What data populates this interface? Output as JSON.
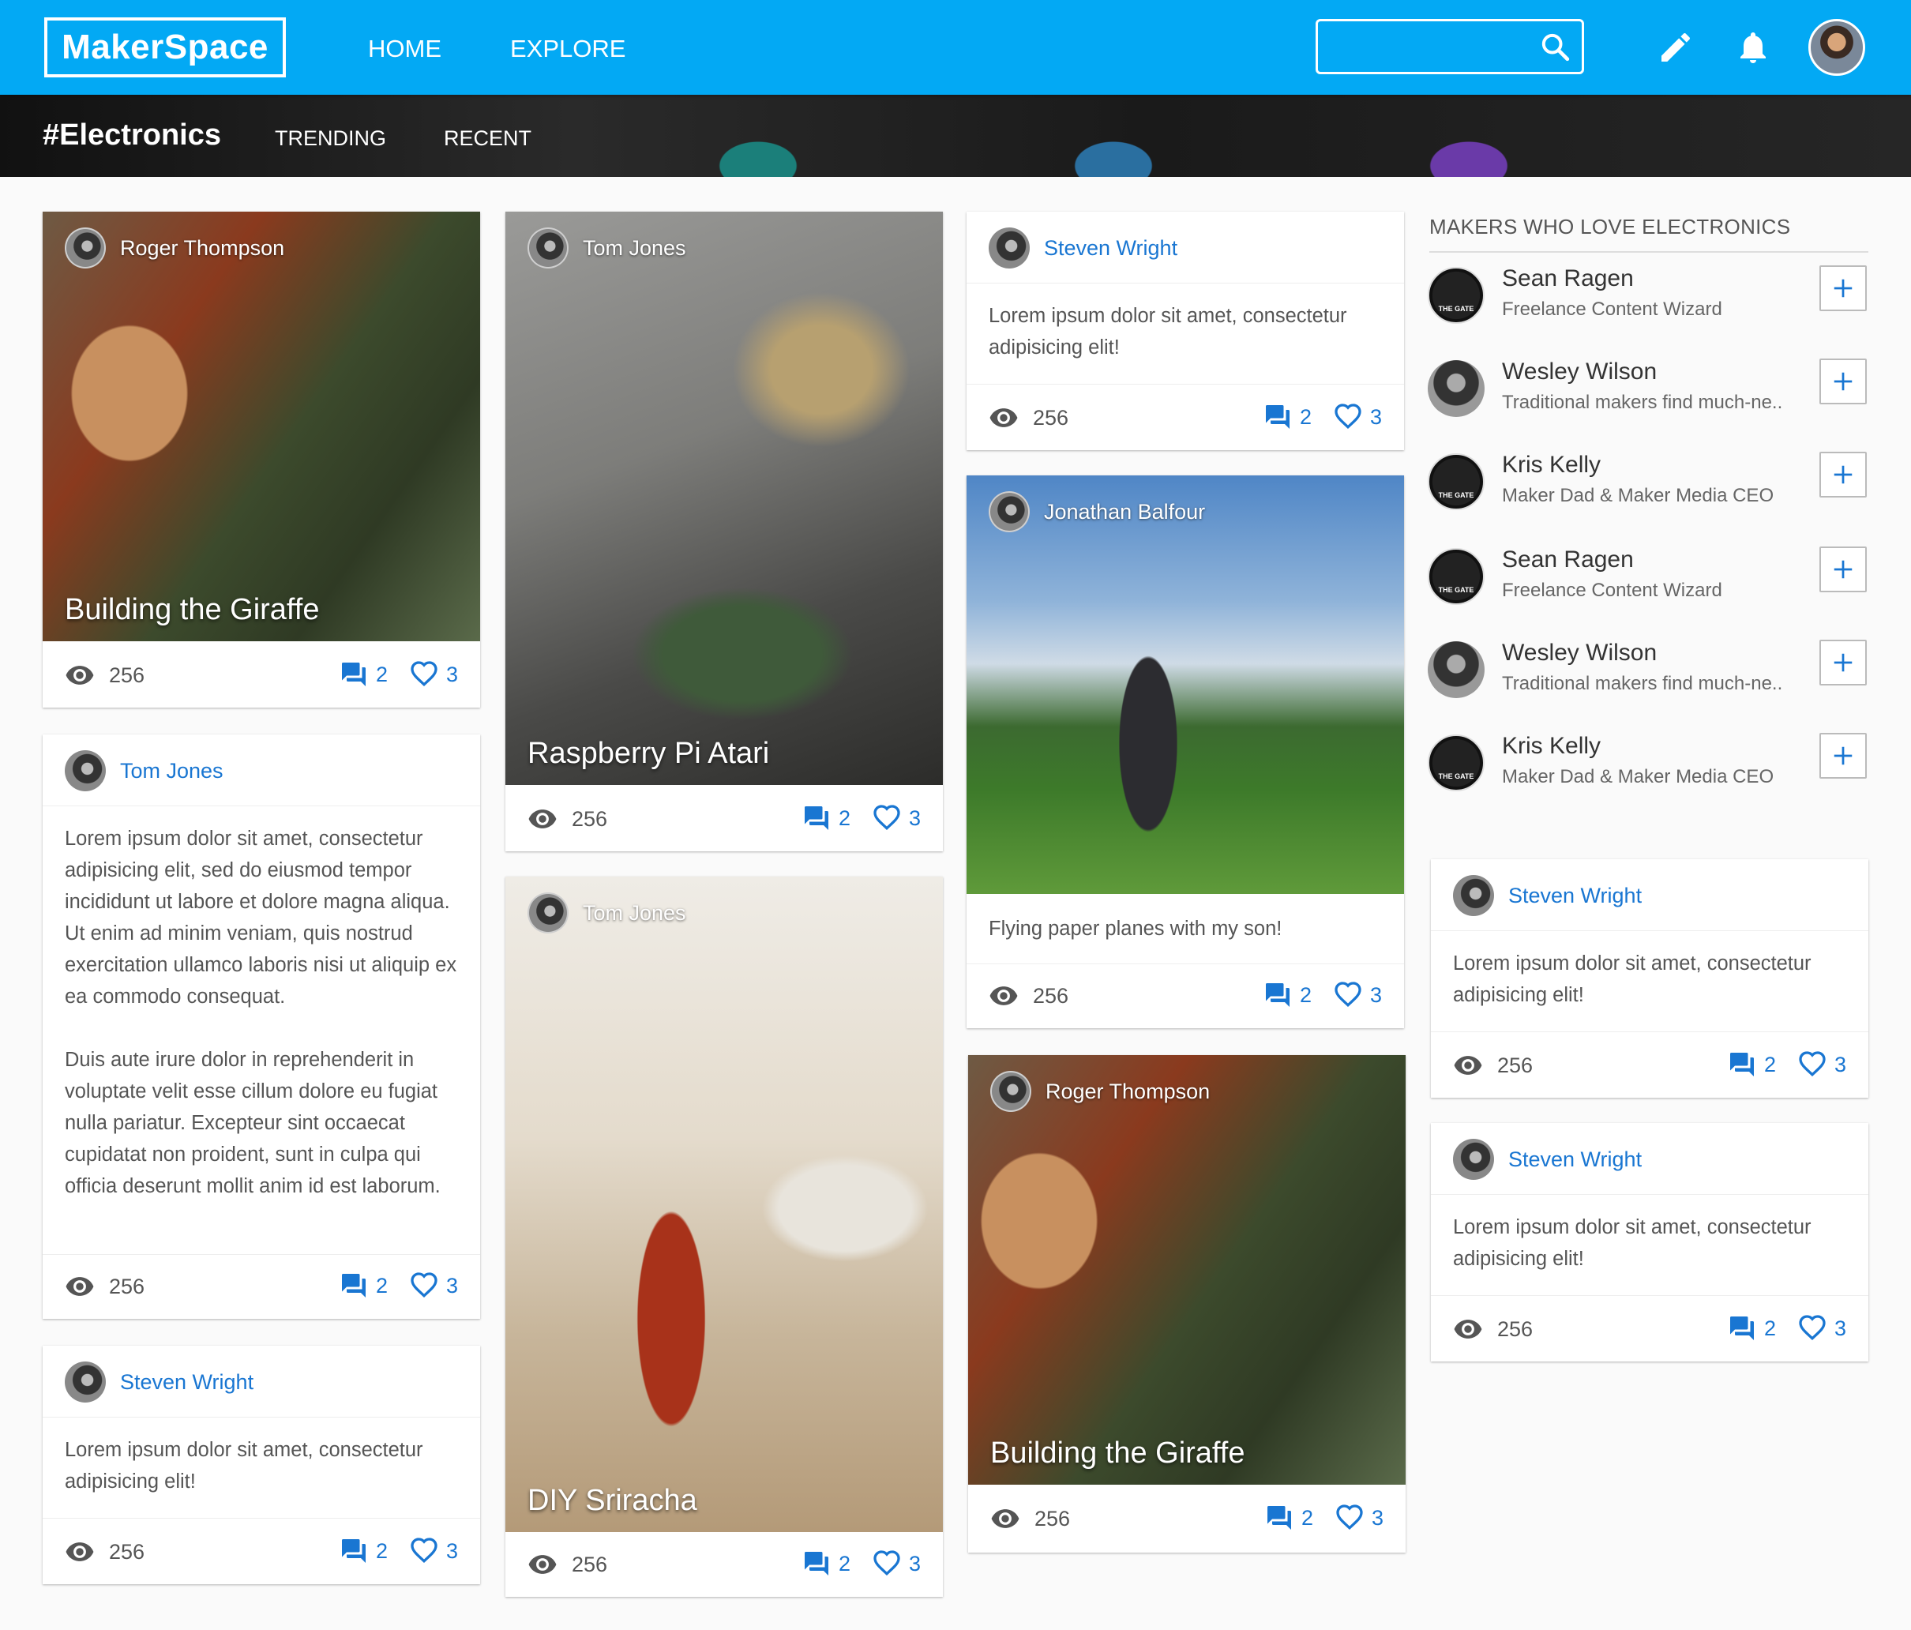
{
  "header": {
    "logo": "MakerSpace",
    "nav": [
      "HOME",
      "EXPLORE"
    ],
    "search": {
      "value": "",
      "placeholder": ""
    }
  },
  "category": {
    "title": "#Electronics",
    "tabs": [
      "TRENDING",
      "RECENT"
    ]
  },
  "colors": {
    "primary": "#03a9f4",
    "link": "#1976d2"
  },
  "cards": [
    {
      "author": "Roger Thompson",
      "title": "Building the Giraffe",
      "views": "256",
      "comments": "2",
      "likes": "3"
    },
    {
      "author": "Tom Jones",
      "text": [
        "Lorem ipsum dolor sit amet, consectetur adipisicing elit, sed do eiusmod tempor incididunt ut labore et dolore magna aliqua. Ut enim ad minim veniam, quis nostrud exercitation ullamco laboris nisi ut aliquip ex ea commodo consequat.",
        "Duis aute irure dolor in reprehenderit in voluptate velit esse cillum dolore eu fugiat nulla pariatur. Excepteur sint occaecat cupidatat non proident, sunt in culpa qui officia deserunt mollit anim id est laborum."
      ],
      "views": "256",
      "comments": "2",
      "likes": "3"
    },
    {
      "author": "Steven Wright",
      "text": "Lorem ipsum dolor sit amet, consectetur adipisicing elit!",
      "views": "256",
      "comments": "2",
      "likes": "3"
    },
    {
      "author": "Tom Jones",
      "title": "Raspberry Pi Atari",
      "views": "256",
      "comments": "2",
      "likes": "3"
    },
    {
      "author": "Tom Jones",
      "title": "DIY Sriracha",
      "views": "256",
      "comments": "2",
      "likes": "3"
    },
    {
      "author": "Steven Wright",
      "text": "Lorem ipsum dolor sit amet, consectetur adipisicing elit!",
      "views": "256",
      "comments": "2",
      "likes": "3"
    },
    {
      "author": "Jonathan Balfour",
      "caption": "Flying paper planes with my son!",
      "views": "256",
      "comments": "2",
      "likes": "3"
    },
    {
      "author": "Roger Thompson",
      "title": "Building the Giraffe",
      "views": "256",
      "comments": "2",
      "likes": "3"
    },
    {
      "author": "Steven Wright",
      "text": "Lorem ipsum dolor sit amet, consectetur adipisicing elit!",
      "views": "256",
      "comments": "2",
      "likes": "3"
    },
    {
      "author": "Steven Wright",
      "text": "Lorem ipsum dolor sit amet, consectetur adipisicing elit!",
      "views": "256",
      "comments": "2",
      "likes": "3"
    }
  ],
  "sidebar": {
    "heading": "MAKERS WHO LOVE ELECTRONICS",
    "makers": [
      {
        "name": "Sean Ragen",
        "sub": "Freelance Content Wizard",
        "avatar_text": "THE GATE"
      },
      {
        "name": "Wesley Wilson",
        "sub": "Traditional makers find much-ne.."
      },
      {
        "name": "Kris Kelly",
        "sub": "Maker Dad & Maker Media CEO",
        "avatar_text": "THE GATE"
      },
      {
        "name": "Sean Ragen",
        "sub": "Freelance Content Wizard",
        "avatar_text": "THE GATE"
      },
      {
        "name": "Wesley Wilson",
        "sub": "Traditional makers find much-ne.."
      },
      {
        "name": "Kris Kelly",
        "sub": "Maker Dad & Maker Media CEO",
        "avatar_text": "THE GATE"
      }
    ]
  }
}
